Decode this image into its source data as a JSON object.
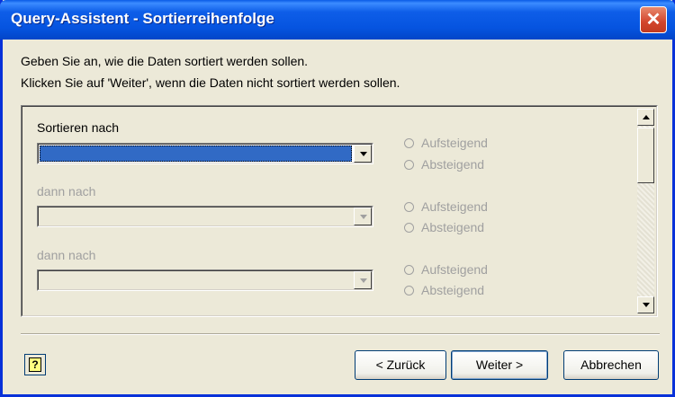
{
  "window": {
    "title": "Query-Assistent - Sortierreihenfolge",
    "close_glyph": "✕"
  },
  "instructions": {
    "line1": "Geben Sie an, wie die Daten sortiert werden sollen.",
    "line2": "Klicken Sie auf 'Weiter', wenn die Daten nicht sortiert werden sollen."
  },
  "sort_rows": [
    {
      "label": "Sortieren nach",
      "value": "",
      "asc": "Aufsteigend",
      "desc": "Absteigend"
    },
    {
      "label": "dann nach",
      "value": "",
      "asc": "Aufsteigend",
      "desc": "Absteigend"
    },
    {
      "label": "dann nach",
      "value": "",
      "asc": "Aufsteigend",
      "desc": "Absteigend"
    }
  ],
  "buttons": {
    "help": "?",
    "back": "< Zurück",
    "next": "Weiter >",
    "cancel": "Abbrechen"
  }
}
